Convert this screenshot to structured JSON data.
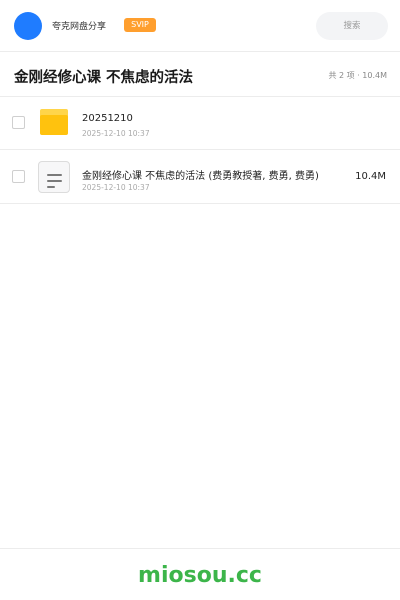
{
  "header": {
    "user_name": "夸克网盘分享",
    "badge": "SVIP",
    "search_placeholder": "搜索"
  },
  "title_bar": {
    "title": "金刚经修心课 不焦虑的活法",
    "summary": "共 2 项 · 10.4M"
  },
  "files": [
    {
      "type": "folder",
      "name": "20251210",
      "date": "2025-12-10 10:37",
      "size": ""
    },
    {
      "type": "document",
      "name": "金刚经修心课 不焦虑的活法 (费勇教授著, 费勇, 费勇)",
      "date": "2025-12-10 10:37",
      "size": "10.4M"
    }
  ],
  "footer": {
    "brand": "miosou.cc"
  },
  "colors": {
    "accent": "#1f7cff",
    "badge": "#ff9f2e",
    "folder": "#ffc20e",
    "brand": "#3cb54a"
  },
  "icons": {
    "avatar": "user-avatar",
    "row1": "folder-icon",
    "row2": "document-icon"
  }
}
